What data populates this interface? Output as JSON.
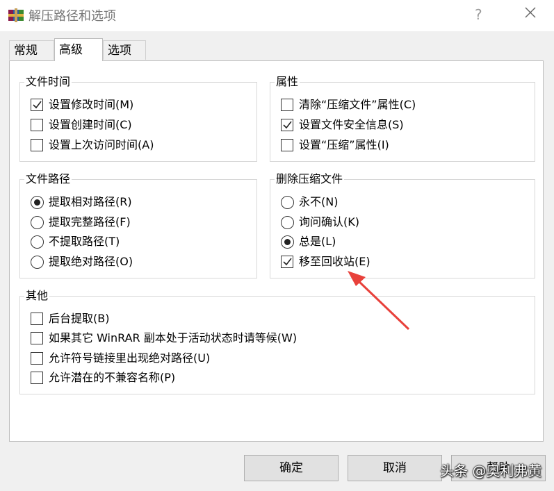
{
  "window": {
    "title": "解压路径和选项",
    "help_symbol": "?"
  },
  "tabs": [
    {
      "label": "常规"
    },
    {
      "label": "高级"
    },
    {
      "label": "选项"
    }
  ],
  "groups": {
    "file_time": {
      "title": "文件时间",
      "items": [
        {
          "label": "设置修改时间(M)",
          "checked": true
        },
        {
          "label": "设置创建时间(C)",
          "checked": false
        },
        {
          "label": "设置上次访问时间(A)",
          "checked": false
        }
      ]
    },
    "attributes": {
      "title": "属性",
      "items": [
        {
          "label": "清除“压缩文件”属性(C)",
          "checked": false
        },
        {
          "label": "设置文件安全信息(S)",
          "checked": true
        },
        {
          "label": "设置“压缩”属性(I)",
          "checked": false
        }
      ]
    },
    "file_path": {
      "title": "文件路径",
      "items": [
        {
          "label": "提取相对路径(R)",
          "selected": true
        },
        {
          "label": "提取完整路径(F)",
          "selected": false
        },
        {
          "label": "不提取路径(T)",
          "selected": false
        },
        {
          "label": "提取绝对路径(O)",
          "selected": false
        }
      ]
    },
    "delete_archive": {
      "title": "删除压缩文件",
      "items": [
        {
          "label": "永不(N)",
          "selected": false
        },
        {
          "label": "询问确认(K)",
          "selected": false
        },
        {
          "label": "总是(L)",
          "selected": true
        }
      ],
      "recycle": {
        "label": "移至回收站(E)",
        "checked": true
      }
    },
    "other": {
      "title": "其他",
      "items": [
        {
          "label": "后台提取(B)",
          "checked": false
        },
        {
          "label": "如果其它 WinRAR 副本处于活动状态时请等候(W)",
          "checked": false
        },
        {
          "label": "允许符号链接里出现绝对路径(U)",
          "checked": false
        },
        {
          "label": "允许潜在的不兼容名称(P)",
          "checked": false
        }
      ]
    }
  },
  "buttons": {
    "ok": "确定",
    "cancel": "取消",
    "help": "帮助"
  },
  "watermark": "头条 @奥利弗黄",
  "colors": {
    "arrow": "#e8413b"
  }
}
